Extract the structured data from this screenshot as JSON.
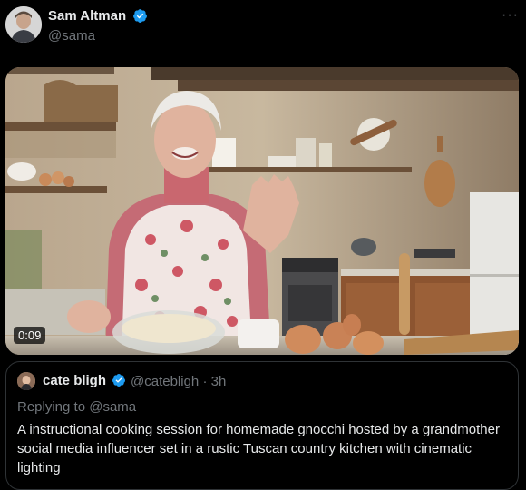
{
  "tweet": {
    "author_name": "Sam Altman",
    "author_handle": "@sama",
    "more_icon": "more-icon",
    "verified_color": "#1d9bf0",
    "media": {
      "duration": "0:09"
    }
  },
  "quote": {
    "author_name": "cate bligh",
    "author_handle": "@catebligh",
    "time": "3h",
    "replying_to_prefix": "Replying to ",
    "replying_to_handle": "@sama",
    "text": "A instructional cooking session for homemade gnocchi hosted by a grandmother social media influencer set in a rustic Tuscan country kitchen with cinematic lighting"
  }
}
